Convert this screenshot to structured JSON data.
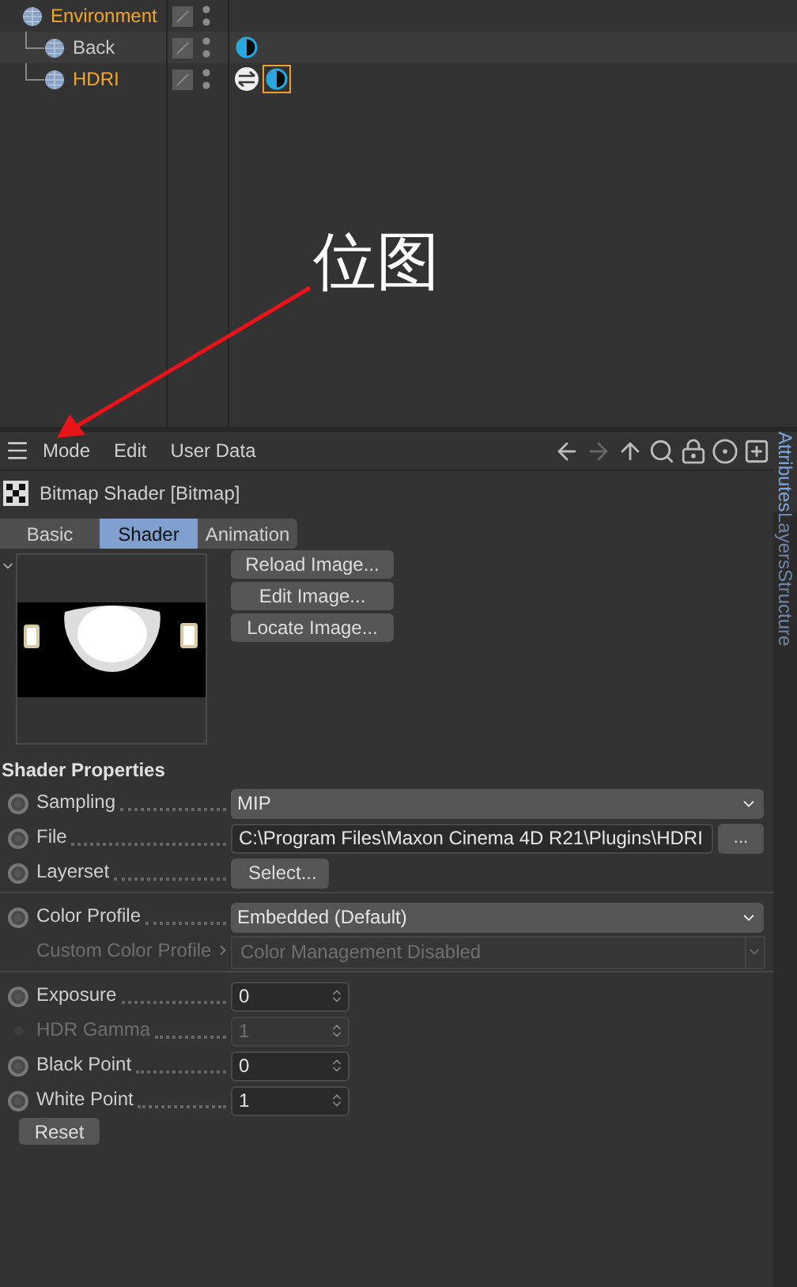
{
  "objects": [
    {
      "name": "Environment",
      "selected": true,
      "children": [
        {
          "name": "Back",
          "selected": false,
          "tags": [
            {
              "kind": "material",
              "selected": false
            }
          ]
        },
        {
          "name": "HDRI",
          "selected": true,
          "tags": [
            {
              "kind": "compositing",
              "selected": false
            },
            {
              "kind": "material",
              "selected": true
            }
          ]
        }
      ]
    }
  ],
  "annotation": {
    "text": "位图"
  },
  "attributes": {
    "menu": [
      "Mode",
      "Edit",
      "User Data"
    ],
    "title": "Bitmap Shader [Bitmap]",
    "tabs": [
      {
        "label": "Basic",
        "selected": false
      },
      {
        "label": "Shader",
        "selected": true
      },
      {
        "label": "Animation",
        "selected": false
      }
    ],
    "image_buttons": [
      "Reload Image...",
      "Edit Image...",
      "Locate Image..."
    ],
    "section": "Shader Properties",
    "groups": [
      [
        {
          "kind": "dropdown",
          "label": "Sampling",
          "value": "MIP",
          "disabled": false,
          "animated": false
        },
        {
          "kind": "file",
          "label": "File",
          "value": "C:\\Program Files\\Maxon Cinema 4D R21\\Plugins\\HDRI",
          "button": "...",
          "disabled": false,
          "animated": false
        },
        {
          "kind": "button",
          "label": "Layerset",
          "value": "Select...",
          "disabled": false,
          "animated": false
        }
      ],
      [
        {
          "kind": "dropdown",
          "label": "Color Profile",
          "value": "Embedded (Default)",
          "disabled": false,
          "animated": false
        },
        {
          "kind": "subdropdown",
          "label": "Custom Color Profile",
          "value": "Color Management Disabled",
          "disabled": true
        }
      ],
      [
        {
          "kind": "number",
          "label": "Exposure",
          "value": "0",
          "disabled": false,
          "animated": false
        },
        {
          "kind": "number",
          "label": "HDR Gamma",
          "value": "1",
          "disabled": true
        },
        {
          "kind": "number",
          "label": "Black Point",
          "value": "0",
          "disabled": false,
          "animated": false
        },
        {
          "kind": "number",
          "label": "White Point",
          "value": "1",
          "disabled": false,
          "animated": false
        }
      ]
    ],
    "reset": "Reset"
  },
  "side_tabs": [
    {
      "label": "Attributes",
      "selected": true
    },
    {
      "label": "Layers",
      "selected": false
    },
    {
      "label": "Structure",
      "selected": false
    }
  ]
}
